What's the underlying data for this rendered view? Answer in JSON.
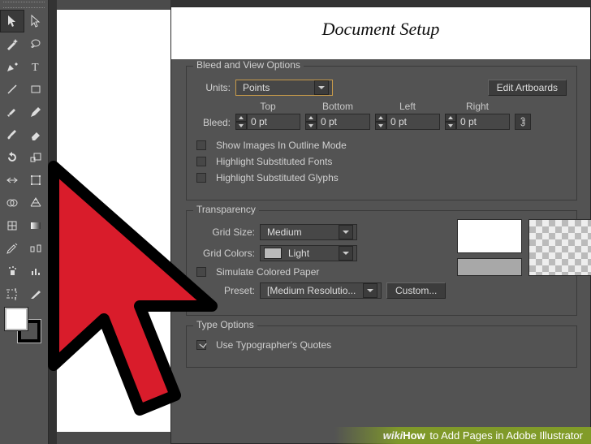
{
  "dialog": {
    "title": "Document Setup",
    "bleed_section": {
      "legend": "Bleed and View Options",
      "units_label": "Units:",
      "units_value": "Points",
      "edit_artboards": "Edit Artboards",
      "bleed_label": "Bleed:",
      "columns": {
        "top": "Top",
        "bottom": "Bottom",
        "left": "Left",
        "right": "Right"
      },
      "values": {
        "top": "0 pt",
        "bottom": "0 pt",
        "left": "0 pt",
        "right": "0 pt"
      },
      "cb_outline": "Show Images In Outline Mode",
      "cb_subfonts": "Highlight Substituted Fonts",
      "cb_subglyphs": "Highlight Substituted Glyphs"
    },
    "transparency": {
      "legend": "Transparency",
      "grid_size_label": "Grid Size:",
      "grid_size_value": "Medium",
      "grid_colors_label": "Grid Colors:",
      "grid_colors_value": "Light",
      "cb_simulate": "Simulate Colored Paper",
      "preset_label": "Preset:",
      "preset_value": "[Medium Resolutio...",
      "custom_btn": "Custom..."
    },
    "type_options": {
      "legend": "Type Options",
      "cb_typographer": "Use Typographer's Quotes"
    }
  },
  "footer": {
    "wiki": "wiki",
    "how": "How",
    "title": " to Add Pages in Adobe Illustrator"
  }
}
